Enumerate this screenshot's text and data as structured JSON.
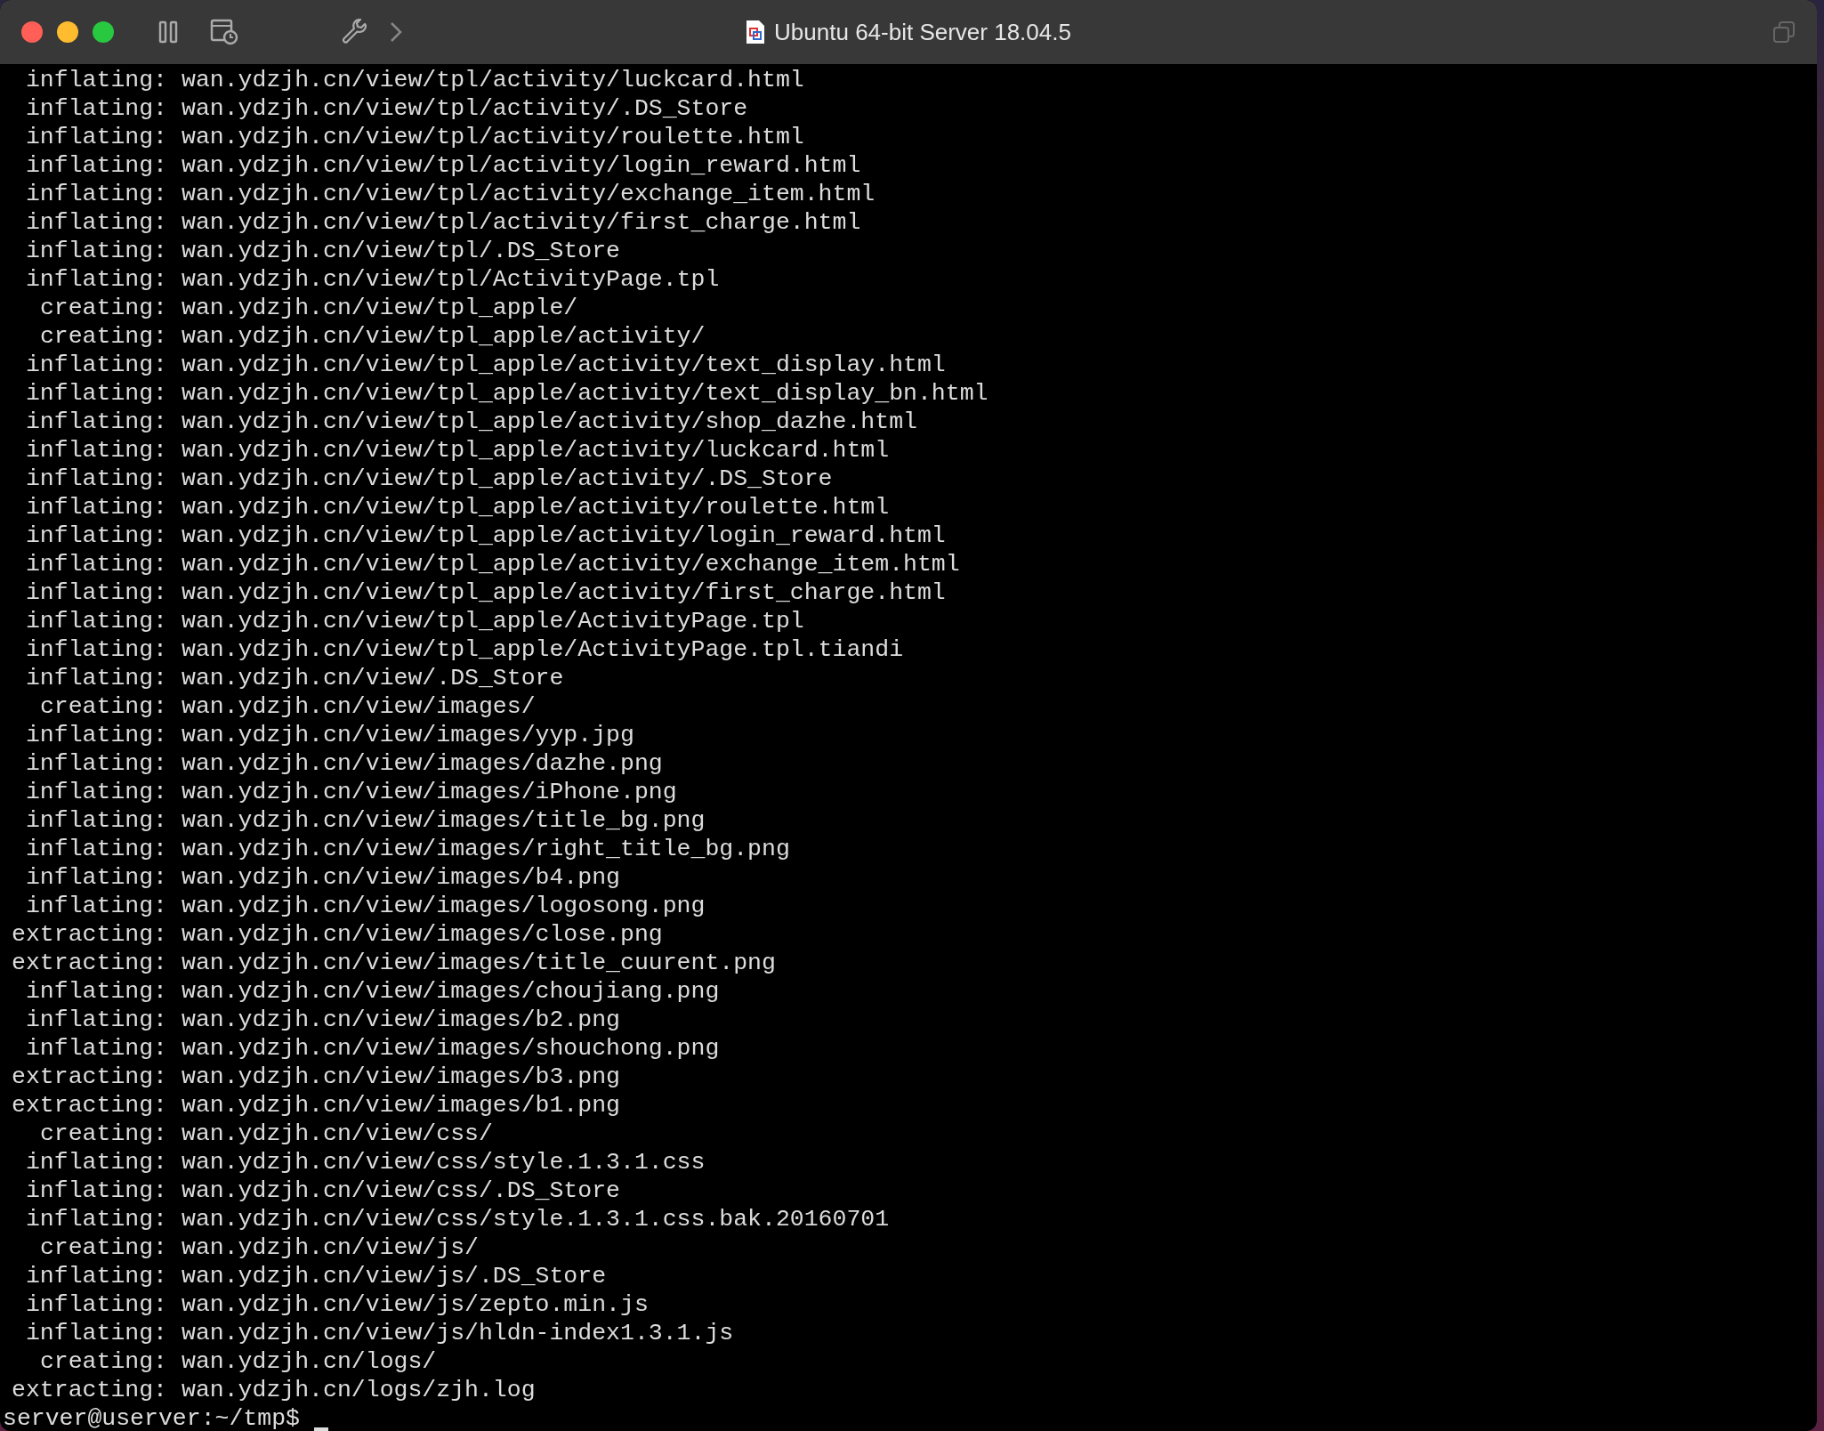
{
  "window": {
    "title": "Ubuntu 64-bit Server 18.04.5"
  },
  "terminal": {
    "lines": [
      {
        "action": "inflating:",
        "path": "wan.ydzjh.cn/view/tpl/activity/luckcard.html"
      },
      {
        "action": "inflating:",
        "path": "wan.ydzjh.cn/view/tpl/activity/.DS_Store"
      },
      {
        "action": "inflating:",
        "path": "wan.ydzjh.cn/view/tpl/activity/roulette.html"
      },
      {
        "action": "inflating:",
        "path": "wan.ydzjh.cn/view/tpl/activity/login_reward.html"
      },
      {
        "action": "inflating:",
        "path": "wan.ydzjh.cn/view/tpl/activity/exchange_item.html"
      },
      {
        "action": "inflating:",
        "path": "wan.ydzjh.cn/view/tpl/activity/first_charge.html"
      },
      {
        "action": "inflating:",
        "path": "wan.ydzjh.cn/view/tpl/.DS_Store"
      },
      {
        "action": "inflating:",
        "path": "wan.ydzjh.cn/view/tpl/ActivityPage.tpl"
      },
      {
        "action": "creating:",
        "path": "wan.ydzjh.cn/view/tpl_apple/"
      },
      {
        "action": "creating:",
        "path": "wan.ydzjh.cn/view/tpl_apple/activity/"
      },
      {
        "action": "inflating:",
        "path": "wan.ydzjh.cn/view/tpl_apple/activity/text_display.html"
      },
      {
        "action": "inflating:",
        "path": "wan.ydzjh.cn/view/tpl_apple/activity/text_display_bn.html"
      },
      {
        "action": "inflating:",
        "path": "wan.ydzjh.cn/view/tpl_apple/activity/shop_dazhe.html"
      },
      {
        "action": "inflating:",
        "path": "wan.ydzjh.cn/view/tpl_apple/activity/luckcard.html"
      },
      {
        "action": "inflating:",
        "path": "wan.ydzjh.cn/view/tpl_apple/activity/.DS_Store"
      },
      {
        "action": "inflating:",
        "path": "wan.ydzjh.cn/view/tpl_apple/activity/roulette.html"
      },
      {
        "action": "inflating:",
        "path": "wan.ydzjh.cn/view/tpl_apple/activity/login_reward.html"
      },
      {
        "action": "inflating:",
        "path": "wan.ydzjh.cn/view/tpl_apple/activity/exchange_item.html"
      },
      {
        "action": "inflating:",
        "path": "wan.ydzjh.cn/view/tpl_apple/activity/first_charge.html"
      },
      {
        "action": "inflating:",
        "path": "wan.ydzjh.cn/view/tpl_apple/ActivityPage.tpl"
      },
      {
        "action": "inflating:",
        "path": "wan.ydzjh.cn/view/tpl_apple/ActivityPage.tpl.tiandi"
      },
      {
        "action": "inflating:",
        "path": "wan.ydzjh.cn/view/.DS_Store"
      },
      {
        "action": "creating:",
        "path": "wan.ydzjh.cn/view/images/"
      },
      {
        "action": "inflating:",
        "path": "wan.ydzjh.cn/view/images/yyp.jpg"
      },
      {
        "action": "inflating:",
        "path": "wan.ydzjh.cn/view/images/dazhe.png"
      },
      {
        "action": "inflating:",
        "path": "wan.ydzjh.cn/view/images/iPhone.png"
      },
      {
        "action": "inflating:",
        "path": "wan.ydzjh.cn/view/images/title_bg.png"
      },
      {
        "action": "inflating:",
        "path": "wan.ydzjh.cn/view/images/right_title_bg.png"
      },
      {
        "action": "inflating:",
        "path": "wan.ydzjh.cn/view/images/b4.png"
      },
      {
        "action": "inflating:",
        "path": "wan.ydzjh.cn/view/images/logosong.png"
      },
      {
        "action": "extracting:",
        "path": "wan.ydzjh.cn/view/images/close.png"
      },
      {
        "action": "extracting:",
        "path": "wan.ydzjh.cn/view/images/title_cuurent.png"
      },
      {
        "action": "inflating:",
        "path": "wan.ydzjh.cn/view/images/choujiang.png"
      },
      {
        "action": "inflating:",
        "path": "wan.ydzjh.cn/view/images/b2.png"
      },
      {
        "action": "inflating:",
        "path": "wan.ydzjh.cn/view/images/shouchong.png"
      },
      {
        "action": "extracting:",
        "path": "wan.ydzjh.cn/view/images/b3.png"
      },
      {
        "action": "extracting:",
        "path": "wan.ydzjh.cn/view/images/b1.png"
      },
      {
        "action": "creating:",
        "path": "wan.ydzjh.cn/view/css/"
      },
      {
        "action": "inflating:",
        "path": "wan.ydzjh.cn/view/css/style.1.3.1.css"
      },
      {
        "action": "inflating:",
        "path": "wan.ydzjh.cn/view/css/.DS_Store"
      },
      {
        "action": "inflating:",
        "path": "wan.ydzjh.cn/view/css/style.1.3.1.css.bak.20160701"
      },
      {
        "action": "creating:",
        "path": "wan.ydzjh.cn/view/js/"
      },
      {
        "action": "inflating:",
        "path": "wan.ydzjh.cn/view/js/.DS_Store"
      },
      {
        "action": "inflating:",
        "path": "wan.ydzjh.cn/view/js/zepto.min.js"
      },
      {
        "action": "inflating:",
        "path": "wan.ydzjh.cn/view/js/hldn-index1.3.1.js"
      },
      {
        "action": "creating:",
        "path": "wan.ydzjh.cn/logs/"
      },
      {
        "action": "extracting:",
        "path": "wan.ydzjh.cn/logs/zjh.log"
      }
    ],
    "prompt": "server@userver:~/tmp$"
  }
}
